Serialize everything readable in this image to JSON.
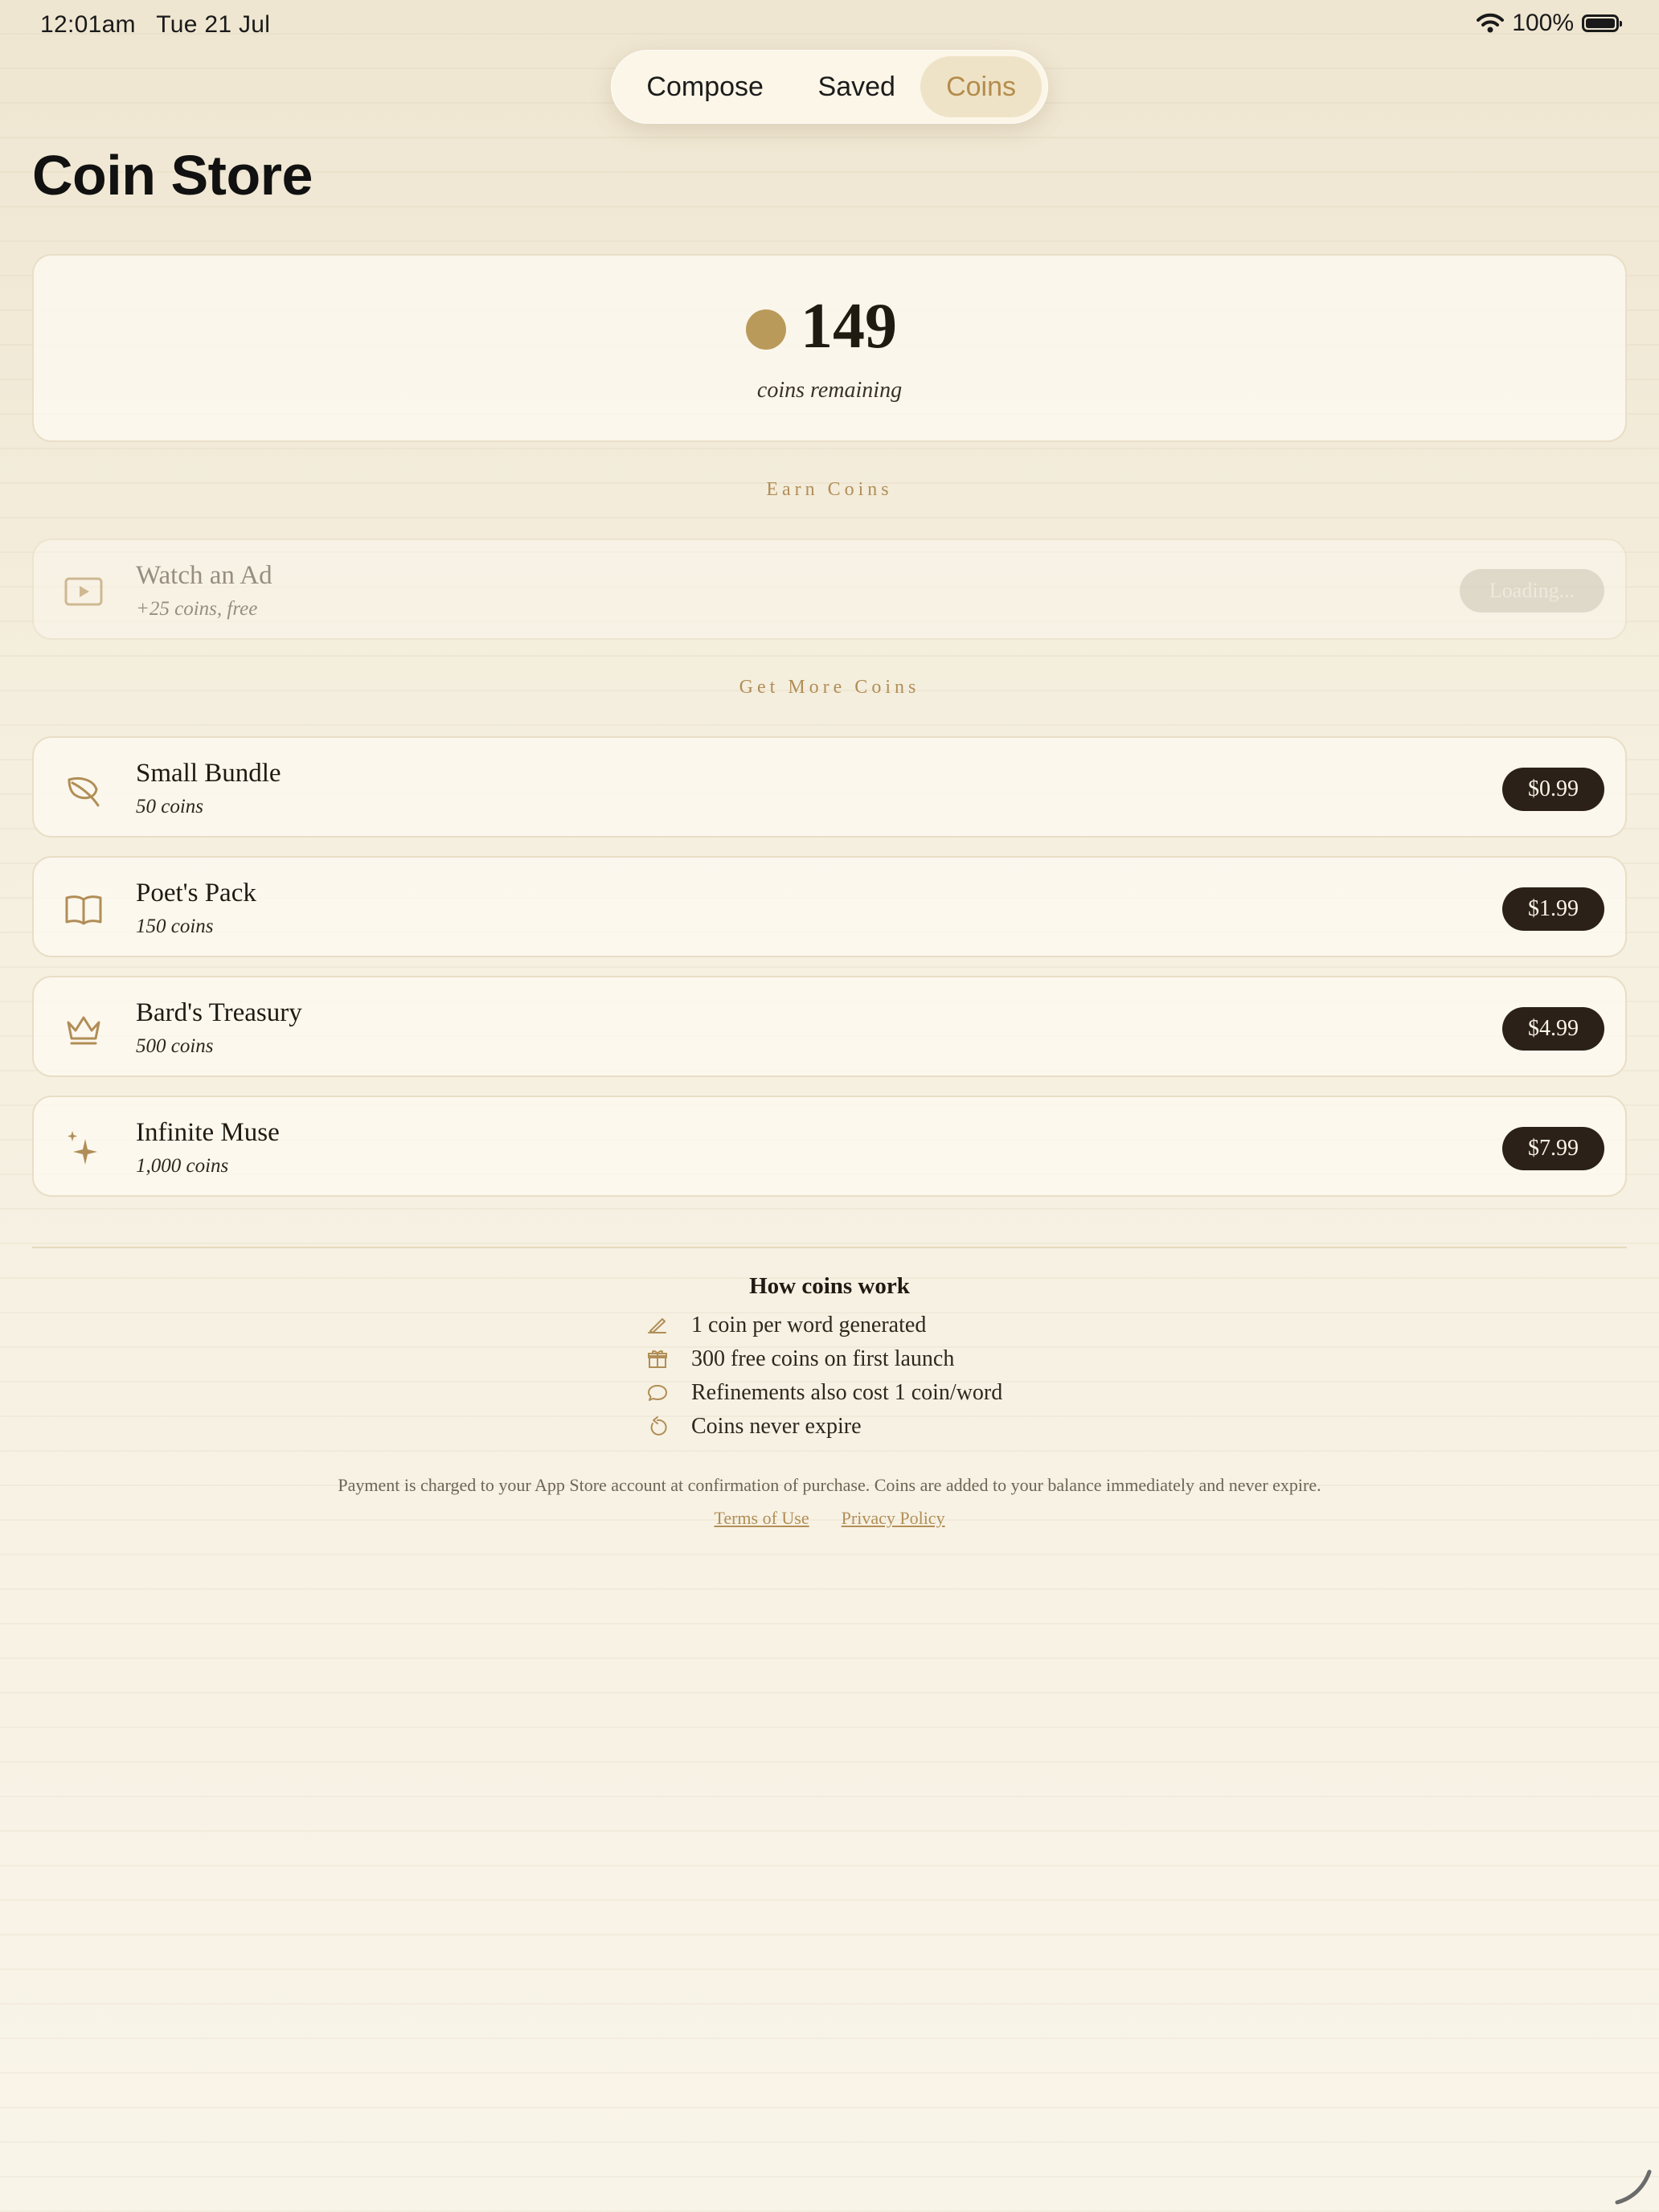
{
  "status_bar": {
    "time": "12:01am",
    "date": "Tue 21 Jul",
    "battery": "100%"
  },
  "tabs": [
    {
      "label": "Compose",
      "selected": false
    },
    {
      "label": "Saved",
      "selected": false
    },
    {
      "label": "Coins",
      "selected": true
    }
  ],
  "page_title": "Coin Store",
  "balance": {
    "value": "149",
    "label": "coins remaining"
  },
  "earn": {
    "section_label": "Earn Coins",
    "ad": {
      "title": "Watch an Ad",
      "subtitle": "+25 coins, free",
      "button": "Loading...",
      "icon": "play-icon"
    }
  },
  "store": {
    "section_label": "Get More Coins",
    "bundles": [
      {
        "title": "Small Bundle",
        "subtitle": "50 coins",
        "price": "$0.99",
        "icon": "leaf-icon"
      },
      {
        "title": "Poet's Pack",
        "subtitle": "150 coins",
        "price": "$1.99",
        "icon": "book-icon"
      },
      {
        "title": "Bard's Treasury",
        "subtitle": "500 coins",
        "price": "$4.99",
        "icon": "crown-icon"
      },
      {
        "title": "Infinite Muse",
        "subtitle": "1,000 coins",
        "price": "$7.99",
        "icon": "sparkles-icon"
      }
    ]
  },
  "how_coins_work": {
    "title": "How coins work",
    "items": [
      {
        "text": "1 coin per word generated",
        "icon": "pencil-icon"
      },
      {
        "text": "300 free coins on first launch",
        "icon": "gift-icon"
      },
      {
        "text": "Refinements also cost 1 coin/word",
        "icon": "speech-bubble-icon"
      },
      {
        "text": "Coins never expire",
        "icon": "refresh-icon"
      }
    ]
  },
  "legal": {
    "text": "Payment is charged to your App Store account at confirmation of purchase. Coins are added to your balance immediately and never expire.",
    "terms": "Terms of Use",
    "privacy": "Privacy Policy"
  },
  "colors": {
    "accent": "#b18e57",
    "coin": "#b99a5a",
    "button_dark": "#2b2118",
    "background": "#f8f3e6"
  }
}
